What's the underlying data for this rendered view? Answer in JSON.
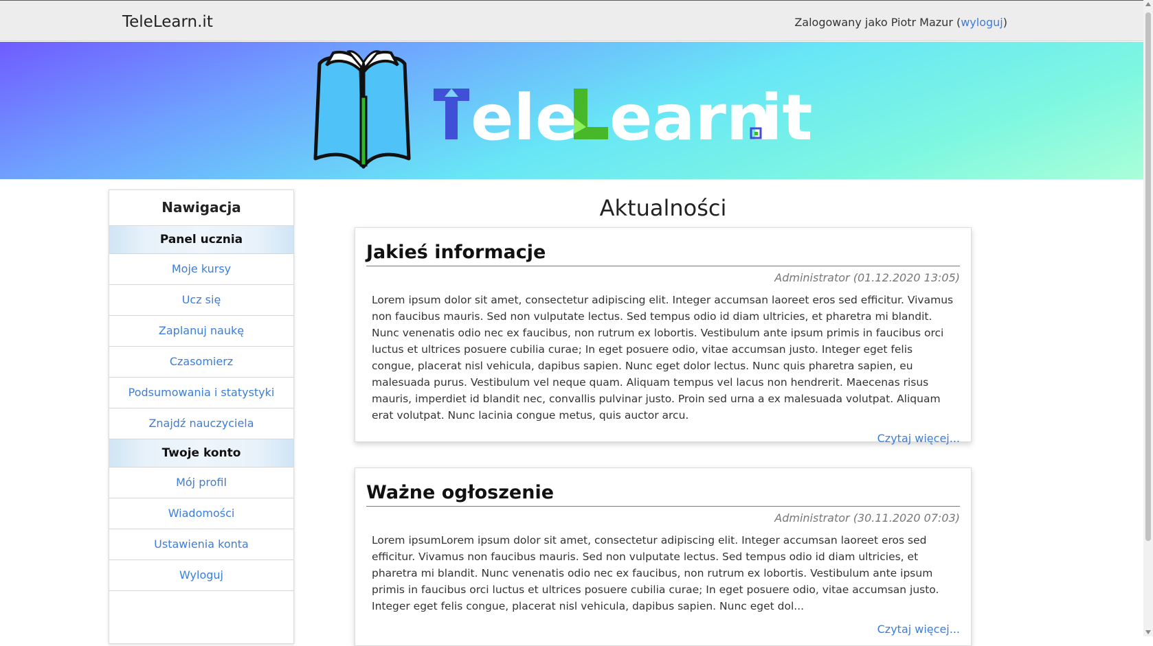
{
  "topbar": {
    "brand": "TeleLearn.it",
    "login_prefix": "Zalogowany jako Piotr Mazur (",
    "logout_link": "wyloguj",
    "login_suffix": ")"
  },
  "banner": {
    "logo_text": "TeleLearn.it"
  },
  "sidebar": {
    "title": "Nawigacja",
    "section1": "Panel ucznia",
    "items1": [
      "Moje kursy",
      "Ucz się",
      "Zaplanuj naukę",
      "Czasomierz",
      "Podsumowania i statystyki",
      "Znajdź nauczyciela"
    ],
    "section2": "Twoje konto",
    "items2": [
      "Mój profil",
      "Wiadomości",
      "Ustawienia konta",
      "Wyloguj"
    ]
  },
  "main": {
    "title": "Aktualności",
    "posts": [
      {
        "title": "Jakieś informacje",
        "meta": "Administrator (01.12.2020 13:05)",
        "body": "Lorem ipsum dolor sit amet, consectetur adipiscing elit. Integer accumsan laoreet eros sed efficitur. Vivamus non faucibus mauris. Sed non vulputate lectus. Sed tempus odio id diam ultricies, et pharetra mi blandit. Nunc venenatis odio nec ex faucibus, non rutrum ex lobortis. Vestibulum ante ipsum primis in faucibus orci luctus et ultrices posuere cubilia curae; In eget posuere odio, vitae accumsan justo. Integer eget felis congue, placerat nisl vehicula, dapibus sapien. Nunc eget dolor lectus. Nunc quis pharetra sapien, eu malesuada purus. Vestibulum vel neque quam. Aliquam tempus vel lacus non hendrerit. Maecenas risus mauris, imperdiet id blandit nec, convallis pulvinar justo. Proin sed urna a ex malesuada volutpat. Aliquam erat volutpat. Nunc lacinia congue metus, quis auctor arcu.",
        "more": "Czytaj więcej..."
      },
      {
        "title": "Ważne ogłoszenie",
        "meta": "Administrator (30.11.2020 07:03)",
        "body": "Lorem ipsumLorem ipsum dolor sit amet, consectetur adipiscing elit. Integer accumsan laoreet eros sed efficitur. Vivamus non faucibus mauris. Sed non vulputate lectus. Sed tempus odio id diam ultricies, et pharetra mi blandit. Nunc venenatis odio nec ex faucibus, non rutrum ex lobortis. Vestibulum ante ipsum primis in faucibus orci luctus et ultrices posuere cubilia curae; In eget posuere odio, vitae accumsan justo. Integer eget felis congue, placerat nisl vehicula, dapibus sapien. Nunc eget dol...",
        "more": "Czytaj więcej..."
      }
    ]
  },
  "colors": {
    "link": "#3b7ddd",
    "logo_T": "#3f4fd6",
    "logo_L": "#46b82a"
  }
}
